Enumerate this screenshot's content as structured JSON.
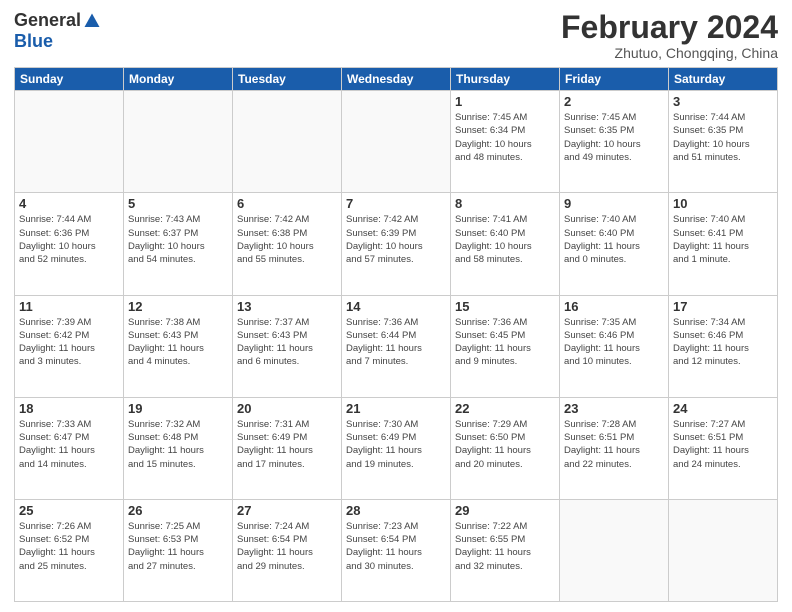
{
  "header": {
    "logo_general": "General",
    "logo_blue": "Blue",
    "month_title": "February 2024",
    "location": "Zhutuo, Chongqing, China"
  },
  "weekdays": [
    "Sunday",
    "Monday",
    "Tuesday",
    "Wednesday",
    "Thursday",
    "Friday",
    "Saturday"
  ],
  "weeks": [
    [
      {
        "day": "",
        "info": ""
      },
      {
        "day": "",
        "info": ""
      },
      {
        "day": "",
        "info": ""
      },
      {
        "day": "",
        "info": ""
      },
      {
        "day": "1",
        "info": "Sunrise: 7:45 AM\nSunset: 6:34 PM\nDaylight: 10 hours\nand 48 minutes."
      },
      {
        "day": "2",
        "info": "Sunrise: 7:45 AM\nSunset: 6:35 PM\nDaylight: 10 hours\nand 49 minutes."
      },
      {
        "day": "3",
        "info": "Sunrise: 7:44 AM\nSunset: 6:35 PM\nDaylight: 10 hours\nand 51 minutes."
      }
    ],
    [
      {
        "day": "4",
        "info": "Sunrise: 7:44 AM\nSunset: 6:36 PM\nDaylight: 10 hours\nand 52 minutes."
      },
      {
        "day": "5",
        "info": "Sunrise: 7:43 AM\nSunset: 6:37 PM\nDaylight: 10 hours\nand 54 minutes."
      },
      {
        "day": "6",
        "info": "Sunrise: 7:42 AM\nSunset: 6:38 PM\nDaylight: 10 hours\nand 55 minutes."
      },
      {
        "day": "7",
        "info": "Sunrise: 7:42 AM\nSunset: 6:39 PM\nDaylight: 10 hours\nand 57 minutes."
      },
      {
        "day": "8",
        "info": "Sunrise: 7:41 AM\nSunset: 6:40 PM\nDaylight: 10 hours\nand 58 minutes."
      },
      {
        "day": "9",
        "info": "Sunrise: 7:40 AM\nSunset: 6:40 PM\nDaylight: 11 hours\nand 0 minutes."
      },
      {
        "day": "10",
        "info": "Sunrise: 7:40 AM\nSunset: 6:41 PM\nDaylight: 11 hours\nand 1 minute."
      }
    ],
    [
      {
        "day": "11",
        "info": "Sunrise: 7:39 AM\nSunset: 6:42 PM\nDaylight: 11 hours\nand 3 minutes."
      },
      {
        "day": "12",
        "info": "Sunrise: 7:38 AM\nSunset: 6:43 PM\nDaylight: 11 hours\nand 4 minutes."
      },
      {
        "day": "13",
        "info": "Sunrise: 7:37 AM\nSunset: 6:43 PM\nDaylight: 11 hours\nand 6 minutes."
      },
      {
        "day": "14",
        "info": "Sunrise: 7:36 AM\nSunset: 6:44 PM\nDaylight: 11 hours\nand 7 minutes."
      },
      {
        "day": "15",
        "info": "Sunrise: 7:36 AM\nSunset: 6:45 PM\nDaylight: 11 hours\nand 9 minutes."
      },
      {
        "day": "16",
        "info": "Sunrise: 7:35 AM\nSunset: 6:46 PM\nDaylight: 11 hours\nand 10 minutes."
      },
      {
        "day": "17",
        "info": "Sunrise: 7:34 AM\nSunset: 6:46 PM\nDaylight: 11 hours\nand 12 minutes."
      }
    ],
    [
      {
        "day": "18",
        "info": "Sunrise: 7:33 AM\nSunset: 6:47 PM\nDaylight: 11 hours\nand 14 minutes."
      },
      {
        "day": "19",
        "info": "Sunrise: 7:32 AM\nSunset: 6:48 PM\nDaylight: 11 hours\nand 15 minutes."
      },
      {
        "day": "20",
        "info": "Sunrise: 7:31 AM\nSunset: 6:49 PM\nDaylight: 11 hours\nand 17 minutes."
      },
      {
        "day": "21",
        "info": "Sunrise: 7:30 AM\nSunset: 6:49 PM\nDaylight: 11 hours\nand 19 minutes."
      },
      {
        "day": "22",
        "info": "Sunrise: 7:29 AM\nSunset: 6:50 PM\nDaylight: 11 hours\nand 20 minutes."
      },
      {
        "day": "23",
        "info": "Sunrise: 7:28 AM\nSunset: 6:51 PM\nDaylight: 11 hours\nand 22 minutes."
      },
      {
        "day": "24",
        "info": "Sunrise: 7:27 AM\nSunset: 6:51 PM\nDaylight: 11 hours\nand 24 minutes."
      }
    ],
    [
      {
        "day": "25",
        "info": "Sunrise: 7:26 AM\nSunset: 6:52 PM\nDaylight: 11 hours\nand 25 minutes."
      },
      {
        "day": "26",
        "info": "Sunrise: 7:25 AM\nSunset: 6:53 PM\nDaylight: 11 hours\nand 27 minutes."
      },
      {
        "day": "27",
        "info": "Sunrise: 7:24 AM\nSunset: 6:54 PM\nDaylight: 11 hours\nand 29 minutes."
      },
      {
        "day": "28",
        "info": "Sunrise: 7:23 AM\nSunset: 6:54 PM\nDaylight: 11 hours\nand 30 minutes."
      },
      {
        "day": "29",
        "info": "Sunrise: 7:22 AM\nSunset: 6:55 PM\nDaylight: 11 hours\nand 32 minutes."
      },
      {
        "day": "",
        "info": ""
      },
      {
        "day": "",
        "info": ""
      }
    ]
  ]
}
